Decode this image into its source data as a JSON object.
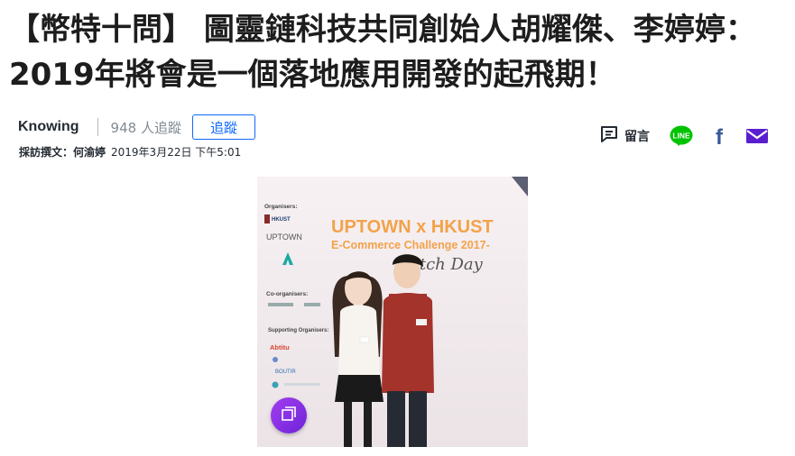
{
  "article": {
    "title": "【幣特十問】 圖靈鏈科技共同創始人胡耀傑、李婷婷：2019年將會是一個落地應用開發的起飛期！",
    "author": "Knowing",
    "followers": "948 人追蹤",
    "follow_label": "追蹤",
    "writer": "採訪撰文：何渝婷",
    "published": "2019年3月22日 下午5:01"
  },
  "actions": {
    "comment_label": "留言",
    "icons": [
      "comment-icon",
      "line-icon",
      "facebook-icon",
      "mail-icon"
    ]
  },
  "photo": {
    "banner_line1": "UPTOWN x HKUST",
    "banner_line2": "E-Commerce Challenge 2017-",
    "banner_line3": "Pitch Day",
    "organisers_label": "Organisers:",
    "org1": "HKUST",
    "org2": "UPTOWN",
    "coorganisers_label": "Co-organisers:",
    "supporting_label": "Supporting Organisers:",
    "sponsor1": "Abtitu",
    "sponsor2": "BOUTIR"
  },
  "colors": {
    "accent": "#0f69ff",
    "line_green": "#00c300",
    "facebook_blue": "#3b5998",
    "mail_purple": "#5b1ecf",
    "gallery_purple": "#8a2be2"
  }
}
